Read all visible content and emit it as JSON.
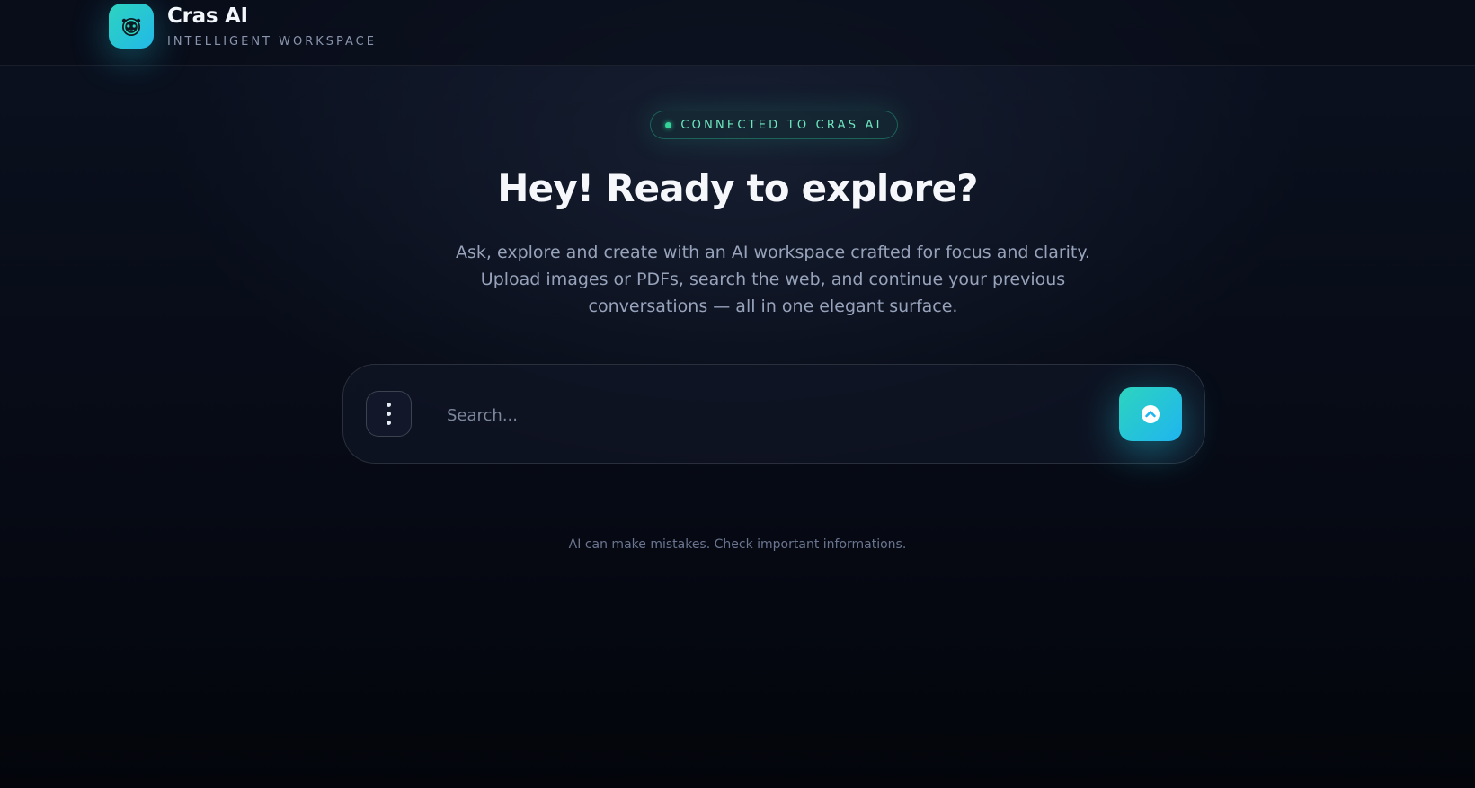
{
  "header": {
    "brand_name": "Cras AI",
    "brand_tagline": "INTELLIGENT WORKSPACE",
    "logo_icon": "robot-head-icon"
  },
  "status": {
    "label": "CONNECTED TO CRAS AI",
    "color": "#34d399"
  },
  "hero": {
    "title": "Hey! Ready to explore?",
    "subtitle": "Ask, explore and create with an AI workspace crafted for focus and clarity. Upload images or PDFs, search the web, and continue your previous conversations — all in one elegant surface."
  },
  "search": {
    "placeholder": "Search...",
    "value": "",
    "menu_icon": "vertical-dots-icon",
    "send_icon": "chevron-up-circle-icon"
  },
  "footer": {
    "disclaimer": "AI can make mistakes. Check important informations."
  },
  "colors": {
    "accent_start": "#2dd4bf",
    "accent_end": "#1fb5ef",
    "background": "#070b16"
  }
}
